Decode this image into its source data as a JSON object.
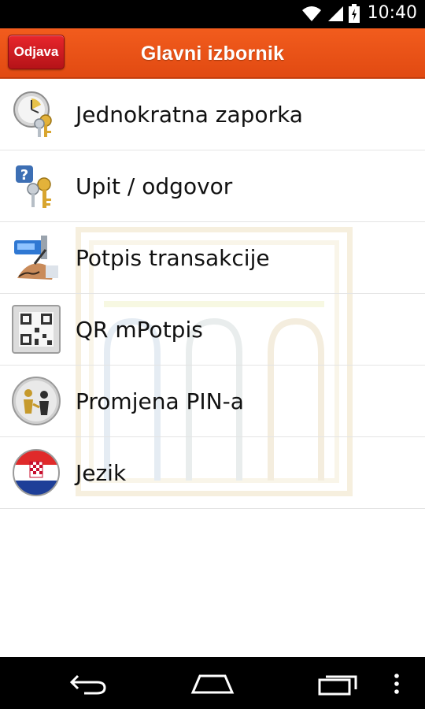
{
  "status_bar": {
    "time": "10:40",
    "icons": [
      "wifi-icon",
      "signal-icon",
      "battery-icon"
    ]
  },
  "header": {
    "title": "Glavni izbornik",
    "logout_label": "Odjava"
  },
  "menu": {
    "items": [
      {
        "label": "Jednokratna zaporka",
        "icon": "clock-keys-icon"
      },
      {
        "label": "Upit / odgovor",
        "icon": "question-keys-icon"
      },
      {
        "label": "Potpis transakcije",
        "icon": "signature-device-icon"
      },
      {
        "label": "QR mPotpis",
        "icon": "qr-code-icon"
      },
      {
        "label": "Promjena PIN-a",
        "icon": "people-exchange-icon"
      },
      {
        "label": "Jezik",
        "icon": "croatia-flag-icon"
      }
    ]
  },
  "nav_bar": {
    "buttons": [
      "back-icon",
      "home-icon",
      "recents-icon",
      "overflow-menu-icon"
    ]
  },
  "colors": {
    "header_orange": "#f25c1d",
    "logout_red": "#d21b21",
    "watermark_beige": "#e9d9b3"
  }
}
